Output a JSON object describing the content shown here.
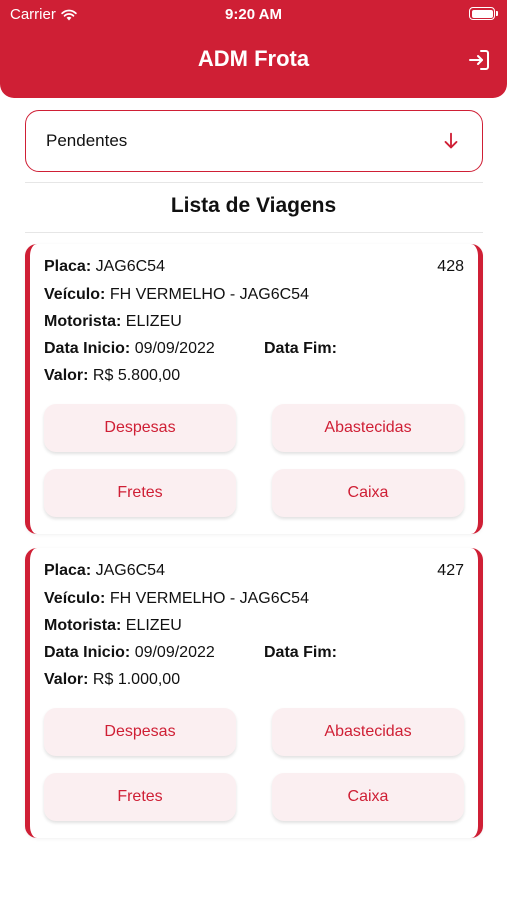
{
  "status_bar": {
    "carrier": "Carrier",
    "time": "9:20 AM"
  },
  "header": {
    "title": "ADM Frota",
    "logout_icon": "logout-icon"
  },
  "filter": {
    "selected": "Pendentes",
    "icon": "arrow-down-icon"
  },
  "list_title": "Lista de Viagens",
  "labels": {
    "placa": "Placa:",
    "veiculo": "Veículo:",
    "motorista": "Motorista:",
    "data_inicio": "Data Inicio:",
    "data_fim": "Data Fim:",
    "valor": "Valor:"
  },
  "buttons": {
    "despesas": "Despesas",
    "abastecidas": "Abastecidas",
    "fretes": "Fretes",
    "caixa": "Caixa"
  },
  "trips": [
    {
      "id": "428",
      "placa": "JAG6C54",
      "veiculo": "FH VERMELHO - JAG6C54",
      "motorista": "ELIZEU",
      "data_inicio": "09/09/2022",
      "data_fim": "",
      "valor": "R$ 5.800,00"
    },
    {
      "id": "427",
      "placa": "JAG6C54",
      "veiculo": "FH VERMELHO - JAG6C54",
      "motorista": "ELIZEU",
      "data_inicio": "09/09/2022",
      "data_fim": "",
      "valor": "R$ 1.000,00"
    }
  ],
  "colors": {
    "brand": "#cf1f35",
    "button_bg": "#fbeff1"
  }
}
